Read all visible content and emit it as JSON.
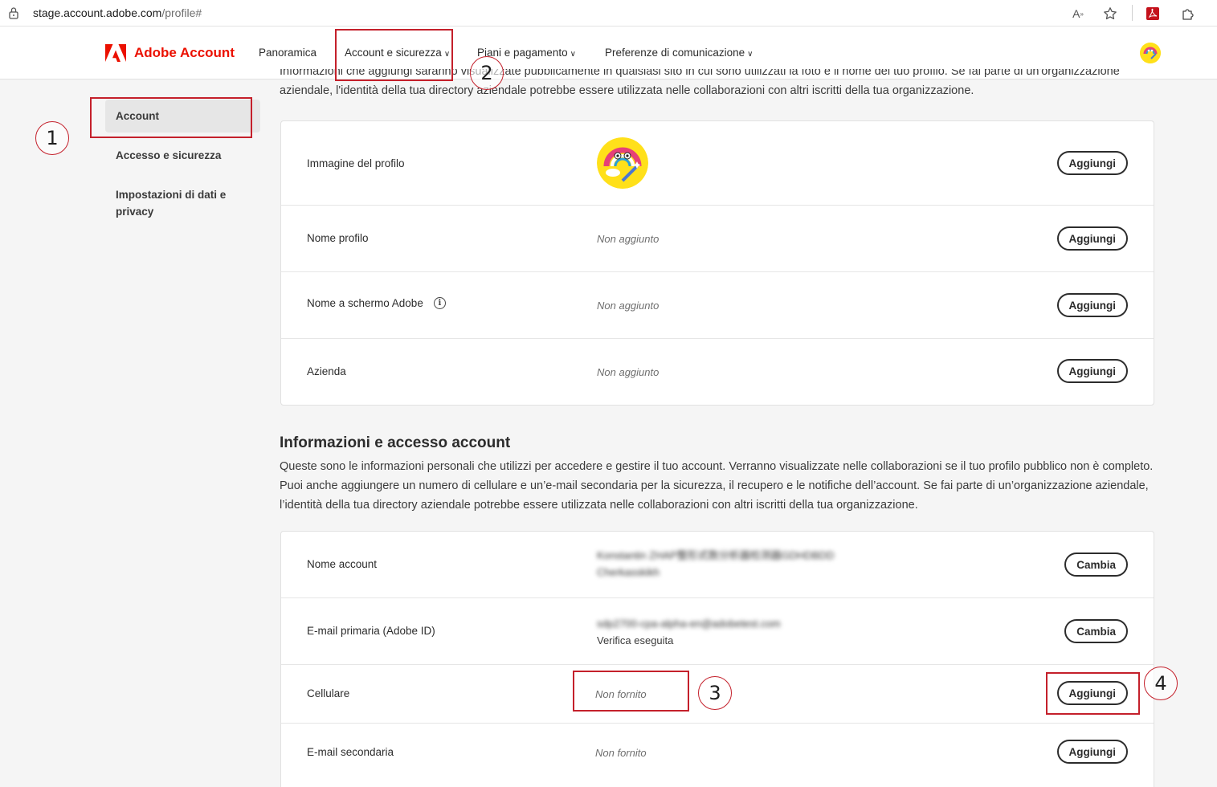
{
  "browser": {
    "url_host": "stage.account.adobe.com",
    "url_path": "/profile#"
  },
  "brand": {
    "name": "Adobe Account",
    "color": "#eb1000"
  },
  "nav": {
    "items": [
      {
        "label": "Panoramica"
      },
      {
        "label": "Account e sicurezza"
      },
      {
        "label": "Piani e pagamento"
      },
      {
        "label": "Preferenze di comunicazione"
      }
    ]
  },
  "sidebar": {
    "items": [
      {
        "label": "Account",
        "active": true
      },
      {
        "label": "Accesso e sicurezza"
      },
      {
        "label": "Impostazioni di dati e privacy"
      }
    ]
  },
  "profile_section": {
    "intro_partial": "Informazioni che aggiungi saranno visualizzate pubblicamente in qualsiasi sito in cui sono utilizzati la foto e il nome del tuo profilo. Se fai parte di un'organizzazione aziendale, l'identità della tua directory aziendale potrebbe essere utilizzata nelle collaborazioni con altri iscritti della tua organizzazione.",
    "rows": [
      {
        "label": "Immagine del profilo",
        "button": "Aggiungi"
      },
      {
        "label": "Nome profilo",
        "value": "Non aggiunto",
        "button": "Aggiungi"
      },
      {
        "label": "Nome a schermo Adobe",
        "value": "Non aggiunto",
        "button": "Aggiungi",
        "info_icon": "i"
      },
      {
        "label": "Azienda",
        "value": "Non aggiunto",
        "button": "Aggiungi"
      }
    ]
  },
  "account_section": {
    "title": "Informazioni e accesso account",
    "description": "Queste sono le informazioni personali che utilizzi per accedere e gestire il tuo account. Verranno visualizzate nelle collaborazioni se il tuo profilo pubblico non è completo. Puoi anche aggiungere un numero di cellulare e un’e-mail secondaria per la sicurezza, il recupero e le notifiche dell’account. Se fai parte di un’organizzazione aziendale, l’identità della tua directory aziendale potrebbe essere utilizzata nelle collaborazioni con altri iscritti della tua organizzazione.",
    "rows": [
      {
        "label": "Nome account",
        "value_line1": "Konstantin ZHAP整形式数分析器检测器GDHDBDD",
        "value_line2": "Cherkasskikh",
        "button": "Cambia"
      },
      {
        "label": "E-mail primaria (Adobe ID)",
        "value_line1": "sdp2700-cpa-alpha-en@adobetest.com",
        "value_line2": "Verifica eseguita",
        "button": "Cambia"
      },
      {
        "label": "Cellulare",
        "value": "Non fornito",
        "button": "Aggiungi"
      },
      {
        "label": "E-mail secondaria",
        "value": "Non fornito",
        "button": "Aggiungi"
      }
    ]
  },
  "annotations": [
    "1",
    "2",
    "3",
    "4"
  ],
  "colors": {
    "annotation_red": "#c4202b"
  }
}
